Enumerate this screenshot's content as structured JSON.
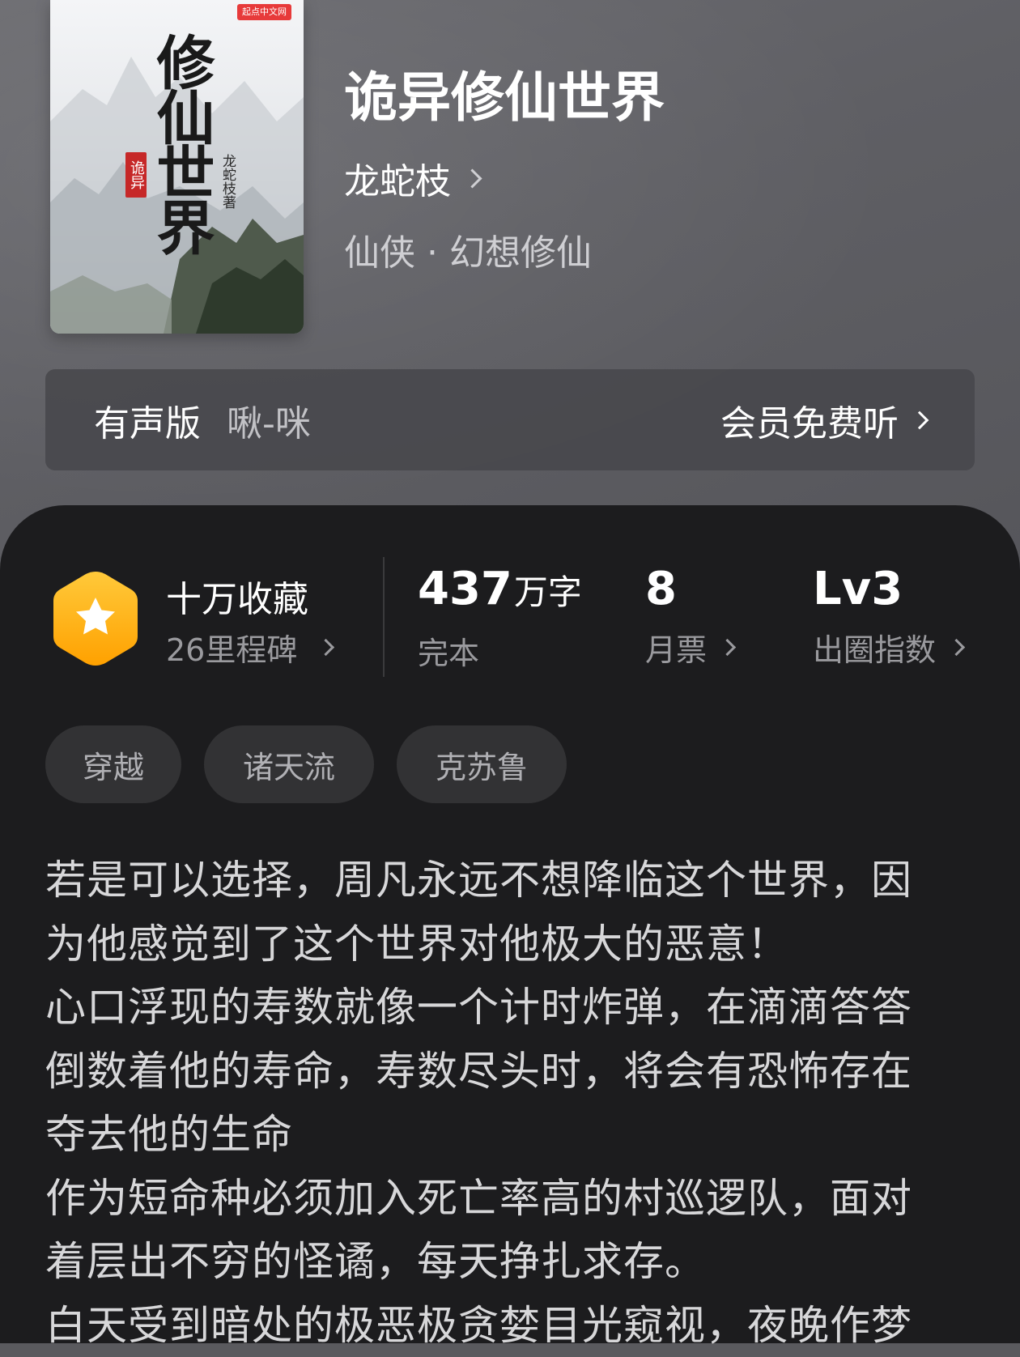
{
  "book": {
    "cover": {
      "publisher_badge": "起点中文网",
      "title_art": "修仙世界",
      "seal_text": "诡异",
      "author_text": "龙蛇枝著"
    },
    "title": "诡异修仙世界",
    "author": "龙蛇枝",
    "genre": "仙侠 · 幻想修仙"
  },
  "audio": {
    "label": "有声版",
    "narrator": "啾-咪",
    "action": "会员免费听"
  },
  "stats": {
    "favorites": "十万收藏",
    "milestones": "26里程碑",
    "word_count_value": "437",
    "word_count_unit": "万字",
    "status": "完本",
    "monthly_tickets_value": "8",
    "monthly_tickets_label": "月票",
    "influence_value": "Lv3",
    "influence_label": "出圈指数"
  },
  "tags": [
    "穿越",
    "诸天流",
    "克苏鲁"
  ],
  "synopsis_lines": [
    "若是可以选择，周凡永远不想降临这个世界，因",
    "为他感觉到了这个世界对他极大的恶意！",
    "心口浮现的寿数就像一个计时炸弹，在滴滴答答",
    "倒数着他的寿命，寿数尽头时，将会有恐怖存在",
    "夺去他的生命",
    "作为短命种必须加入死亡率高的村巡逻队，面对",
    "着层出不穷的怪谲，每天挣扎求存。",
    "白天受到暗处的极恶极贪婪目光窥视，夜晚作梦"
  ],
  "colors": {
    "badge_gold": "#FFB300",
    "panel_bg": "#1C1C1E",
    "tag_bg": "#323234",
    "header_bg": "#5F5F64"
  }
}
